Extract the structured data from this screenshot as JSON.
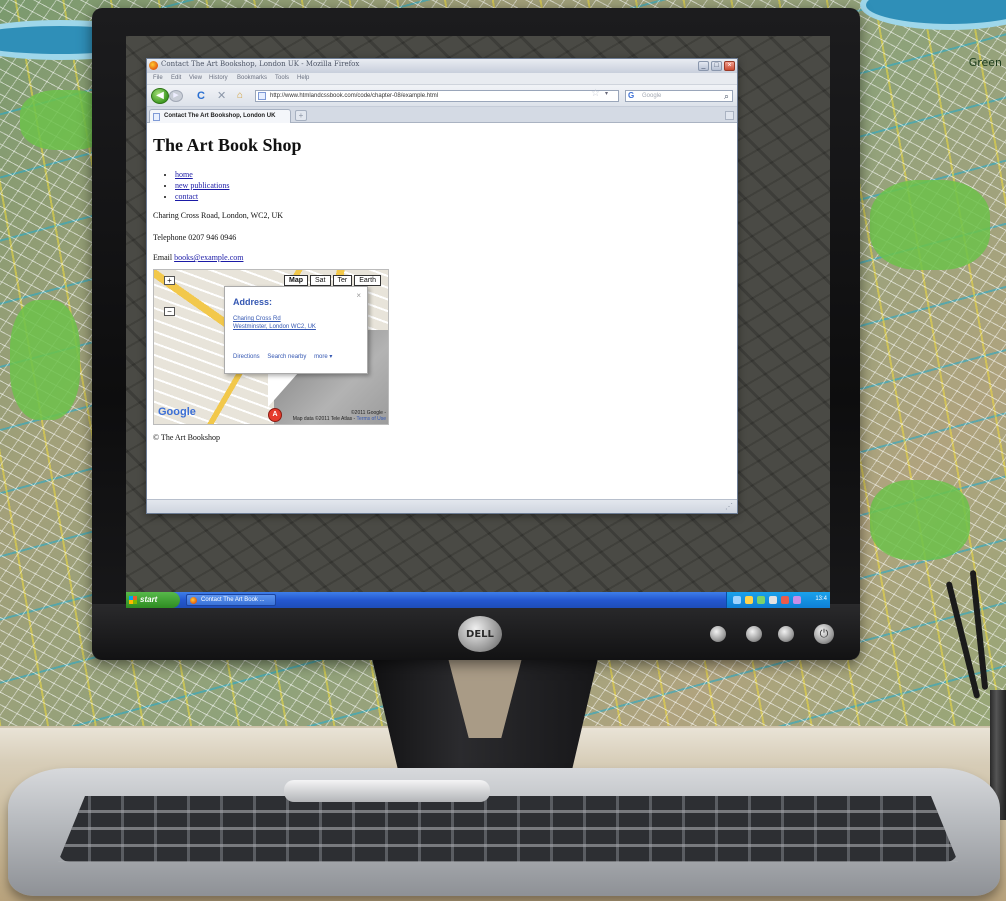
{
  "wall": {
    "map_label": "Green"
  },
  "browser": {
    "window_title": "Contact The Art Bookshop, London UK - Mozilla Firefox",
    "window_controls": {
      "minimize": "_",
      "maximize": "□",
      "close": "×"
    },
    "menu": [
      "File",
      "Edit",
      "View",
      "History",
      "Bookmarks",
      "Tools",
      "Help"
    ],
    "nav": {
      "back": "◀",
      "forward": "▶",
      "reload": "C",
      "stop": "✕",
      "home": "⌂",
      "url": "http://www.htmlandcssbook.com/code/chapter-08/example.html",
      "bookmark_star": "☆",
      "search_engine": "G",
      "search_placeholder": "Google",
      "search_icon": "⌕"
    },
    "tabs": [
      {
        "label": "Contact The Art Bookshop, London UK"
      }
    ],
    "new_tab": "+",
    "status_grip": "⋰"
  },
  "page": {
    "title": "The Art Book Shop",
    "nav_links": [
      "home",
      "new publications",
      "contact"
    ],
    "address": "Charing Cross Road, London, WC2, UK",
    "telephone": "Telephone 0207 946 0946",
    "email_label": "Email ",
    "email_link": "books@example.com",
    "footer": "© The Art Bookshop",
    "map": {
      "zoom_in": "+",
      "zoom_out": "−",
      "types": [
        "Map",
        "Sat",
        "Ter",
        "Earth"
      ],
      "active_type": "Map",
      "info_close": "×",
      "info_heading": "Address:",
      "info_address_line1": "Charing Cross Rd",
      "info_address_line2": "Westminster, London WC2, UK",
      "info_links": [
        "Directions",
        "Search nearby",
        "more ▾"
      ],
      "marker_label": "A",
      "logo": "Google",
      "credit_line1": "©2011 Google -",
      "credit_line2": "Map data ©2011 Tele Atlas -",
      "terms": "Terms of Use"
    }
  },
  "taskbar": {
    "start_label": "start",
    "task_label": "Contact The Art Book ...",
    "clock": "13:4"
  },
  "monitor": {
    "brand": "DELL",
    "power_symbol": "⏻"
  }
}
